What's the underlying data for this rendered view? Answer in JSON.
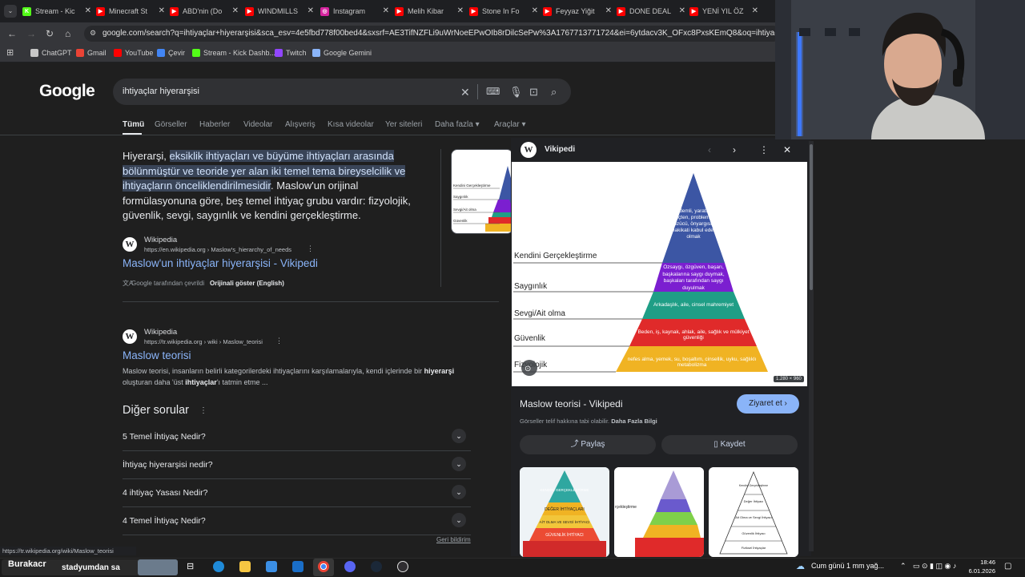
{
  "browser": {
    "tabs": [
      {
        "label": "Stream - Kic",
        "color": "#53fc18",
        "glyph": "K"
      },
      {
        "label": "Minecraft St",
        "color": "#ff0000",
        "glyph": "▶"
      },
      {
        "label": "ABD'nin (Do",
        "color": "#ff0000",
        "glyph": "▶"
      },
      {
        "label": "WINDMILLS",
        "color": "#ff0000",
        "glyph": "▶"
      },
      {
        "label": "Instagram",
        "color": "#d6249f",
        "glyph": "◎"
      },
      {
        "label": "Melih Kibar",
        "color": "#ff0000",
        "glyph": "▶"
      },
      {
        "label": "Stone In Fo",
        "color": "#ff0000",
        "glyph": "▶"
      },
      {
        "label": "Feyyaz Yiğit",
        "color": "#ff0000",
        "glyph": "▶"
      },
      {
        "label": "DONE DEAL",
        "color": "#ff0000",
        "glyph": "▶"
      },
      {
        "label": "YENİ YIL ÖZ",
        "color": "#ff0000",
        "glyph": "▶"
      }
    ],
    "url": "google.com/search?q=ihtiyaçlar+hiyerarşisi&sca_esv=4e5fbd778f00bed4&sxsrf=AE3TifNZFLi9uWrNoeEPwOIb8rDilcSePw%3A1767713771724&ei=6ytdacv3K_OFxc8PxsKEmQ8&oq=ihtiyaçlar+hiyerarşisi&gs_lp=Egxn",
    "bookmarks": [
      {
        "label": "ChatGPT",
        "color": "#c7c7c7"
      },
      {
        "label": "Gmail",
        "color": "#ea4335"
      },
      {
        "label": "YouTube",
        "color": "#ff0000"
      },
      {
        "label": "Çevir",
        "color": "#4285f4"
      },
      {
        "label": "Stream - Kick Dashb...",
        "color": "#53fc18"
      },
      {
        "label": "Twitch",
        "color": "#9146ff"
      },
      {
        "label": "Google Gemini",
        "color": "#8ab4f8"
      }
    ]
  },
  "google": {
    "logo": "Google",
    "query": "ihtiyaçlar hiyerarşisi",
    "tabs": [
      "Tümü",
      "Görseller",
      "Haberler",
      "Videolar",
      "Alışveriş",
      "Kısa videolar",
      "Yer siteleri",
      "Daha fazla ▾",
      "Araçlar ▾"
    ],
    "snippet_pre": "Hiyerarşi, ",
    "snippet_hl": "eksiklik ihtiyaçları ve büyüme ihtiyaçları arasında bölünmüştür ve teoride yer alan iki temel tema bireyselcilik ve ihtiyaçların önceliklendirilmesidir",
    "snippet_post": ". Maslow'un orijinal formülasyonuna göre, beş temel ihtiyaç grubu vardır: fizyolojik, güvenlik, sevgi, saygınlık ve kendini gerçekleştirme.",
    "result1": {
      "site": "Wikipedia",
      "url": "https://en.wikipedia.org › Maslow's_hierarchy_of_needs",
      "title": "Maslow'un ihtiyaçlar hiyerarşisi - Vikipedi",
      "translated": "Google tarafından çevrildi",
      "original": "Orijinali göster (English)"
    },
    "result2": {
      "site": "Wikipedia",
      "url": "https://tr.wikipedia.org › wiki › Maslow_teorisi",
      "title": "Maslow teorisi",
      "desc_a": "Maslow teorisi, insanların belirli kategorilerdeki ihtiyaçlarını karşılamalarıyla, kendi içlerinde bir ",
      "desc_b": "hiyerarşi",
      "desc_c": " oluşturan daha 'üst ",
      "desc_d": "ihtiyaçlar",
      "desc_e": "'ı tatmin etme ..."
    },
    "paa_title": "Diğer sorular",
    "questions": [
      "5 Temel İhtiyaç Nedir?",
      "İhtiyaç hiyerarşisi nedir?",
      "4 ihtiyaç Yasası Nedir?",
      "4 Temel İhtiyaç Nedir?"
    ],
    "feedback": "Geri bildirim",
    "status_url": "https://tr.wikipedia.org/wiki/Maslow_teorisi"
  },
  "panel": {
    "source": "Vikipedi",
    "image_dims": "1.280 × 960",
    "title": "Maslow teorisi - Vikipedi",
    "visit": "Ziyaret et ›",
    "copyright": "Görseller telif hakkına tabi olabilir.",
    "learn_more": "Daha Fazla Bilgi",
    "share": "Paylaş",
    "save": "Kaydet",
    "pyramid": {
      "levels": [
        {
          "left": "Kendini Gerçekleştirme",
          "text": "Erdemli, yaratıcı, içten, problem çözücü, önyargısız, hakikati kabul eder olmak",
          "color": "#3c56a4"
        },
        {
          "left": "Saygınlık",
          "text": "Özsaygı, özgüven, başarı, başkalarına saygı duymak, başkaları tarafından saygı duyulmak",
          "color": "#7b1fd0"
        },
        {
          "left": "Sevgi/Ait olma",
          "text": "Arkadaşlık, aile, cinsel mahremiyet",
          "color": "#1f9e86"
        },
        {
          "left": "Güvenlik",
          "text": "Beden, iş, kaynak, ahlak, aile, sağlık ve mülkiyet güvenliği",
          "color": "#e02a2a"
        },
        {
          "left": "Fizyolojik",
          "text": "nefes alma, yemek, su, boşaltım, cinsellik, uyku, sağlıklı metabolizma",
          "color": "#f0b323"
        }
      ]
    },
    "related": [
      {
        "labels": [
          "KENDİNİ GERÇEKLEŞTİRME",
          "DEĞER İHTİYAÇLARI",
          "AİT OLMA VE SEVGİ İHTİYACI",
          "GÜVENLİK İHTİYACI"
        ]
      },
      {
        "labels": [
          "rçekleştirme"
        ]
      },
      {
        "labels": [
          "Kendini Gerçekleştirme",
          "Değer İhtiyacı",
          "Ait Olma ve Sevgi İhtiyacı",
          "Güvenlik İhtiyacı",
          "Fiziksel İhtiyaçlar"
        ]
      }
    ]
  },
  "taskbar": {
    "overlay_name": "Burakacr",
    "overlay_text": "stadyumdan sa",
    "weather": "Cum günü 1 mm yağ...",
    "time": "18:46",
    "date": "6.01.2026"
  }
}
